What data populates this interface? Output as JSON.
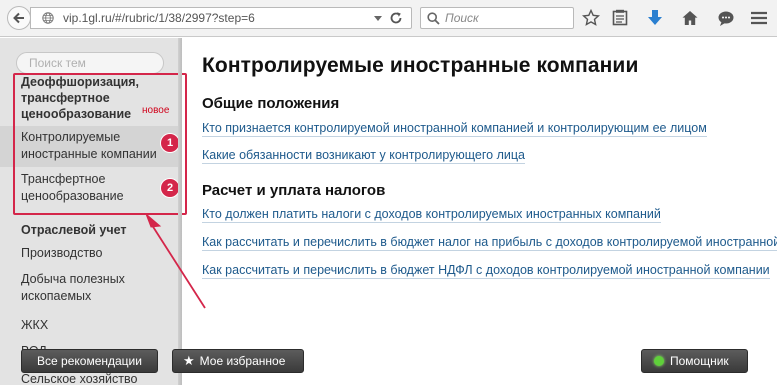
{
  "browser": {
    "url": "vip.1gl.ru/#/rubric/1/38/2997?step=6",
    "search_placeholder": "Поиск",
    "icons": [
      "back-arrow-icon",
      "globe-icon",
      "dropdown-icon",
      "reload-icon",
      "search-icon",
      "bookmark-star-icon",
      "reading-list-icon",
      "download-icon",
      "home-icon",
      "chat-icon",
      "menu-icon"
    ]
  },
  "sidebar": {
    "search_placeholder": "Поиск тем",
    "category_heading": "Деоффшоризация, трансфертное ценообразование",
    "badge_new": "новое",
    "items": [
      {
        "label": "Контролируемые иностранные компании",
        "active": true,
        "marker": "1"
      },
      {
        "label": "Трансфертное ценообразование",
        "active": false,
        "marker": "2"
      }
    ],
    "section_heading": "Отраслевой учет",
    "section_items": [
      "Производство",
      "Добыча полезных ископаемых",
      "ЖКХ",
      "ВОД",
      "Сельское хозяйство"
    ]
  },
  "main": {
    "title": "Контролируемые иностранные компании",
    "sections": [
      {
        "heading": "Общие положения",
        "links": [
          "Кто признается контролируемой иностранной компанией и контролирующим ее лицом",
          "Какие обязанности возникают у контролирующего лица"
        ]
      },
      {
        "heading": "Расчет и уплата налогов",
        "links": [
          "Кто должен платить налоги с доходов контролируемых иностранных компаний",
          "Как рассчитать и перечислить в бюджет налог на прибыль с доходов контролируемой иностранной компании",
          "Как рассчитать и перечислить в бюджет НДФЛ с доходов контролируемой иностранной компании"
        ]
      }
    ]
  },
  "bottom_bar": {
    "all_recommendations": "Все рекомендации",
    "my_favorites": "Мое избранное",
    "assistant": "Помощник"
  },
  "colors": {
    "highlight": "#d4264a",
    "link": "#1e5a8c",
    "assistant_indicator": "#5fd03a"
  }
}
